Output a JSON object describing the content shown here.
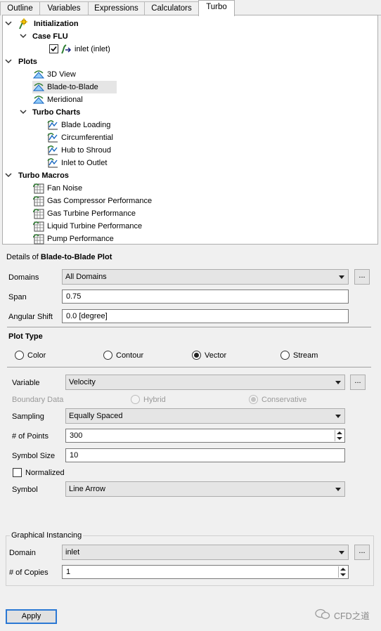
{
  "tabs": [
    {
      "label": "Outline"
    },
    {
      "label": "Variables"
    },
    {
      "label": "Expressions"
    },
    {
      "label": "Calculators"
    },
    {
      "label": "Turbo"
    }
  ],
  "tree": {
    "initialization": "Initialization",
    "case": "Case FLU",
    "inlet": "inlet (inlet)",
    "inlet_checked": true,
    "plots": "Plots",
    "view3d": "3D View",
    "blade": "Blade-to-Blade",
    "meridional": "Meridional",
    "turbo_charts": "Turbo Charts",
    "blade_loading": "Blade Loading",
    "circumferential": "Circumferential",
    "hub_to_shroud": "Hub to Shroud",
    "inlet_to_outlet": "Inlet to Outlet",
    "turbo_macros": "Turbo Macros",
    "fan_noise": "Fan Noise",
    "gas_compressor": "Gas Compressor Performance",
    "gas_turbine": "Gas Turbine Performance",
    "liquid_turbine": "Liquid Turbine Performance",
    "pump": "Pump Performance"
  },
  "details": {
    "prefix": "Details of",
    "name": "Blade-to-Blade Plot",
    "domains_label": "Domains",
    "domains_value": "All Domains",
    "span_label": "Span",
    "span_value": "0.75",
    "angular_label": "Angular Shift",
    "angular_value": "0.0 [degree]",
    "plot_type_label": "Plot Type",
    "plot_types": [
      "Color",
      "Contour",
      "Vector",
      "Stream"
    ],
    "plot_type_selected": "Vector",
    "variable_label": "Variable",
    "variable_value": "Velocity",
    "boundary_label": "Boundary Data",
    "hybrid": "Hybrid",
    "conservative": "Conservative",
    "boundary_selected": "Conservative",
    "sampling_label": "Sampling",
    "sampling_value": "Equally Spaced",
    "points_label": "# of Points",
    "points_value": "300",
    "symbol_size_label": "Symbol Size",
    "symbol_size_value": "10",
    "normalized_label": "Normalized",
    "normalized_checked": false,
    "symbol_label": "Symbol",
    "symbol_value": "Line Arrow",
    "instancing_title": "Graphical Instancing",
    "domain_label": "Domain",
    "domain_value": "inlet",
    "copies_label": "# of Copies",
    "copies_value": "1",
    "more_label": "..."
  },
  "apply_label": "Apply",
  "watermark": "CFD之道"
}
